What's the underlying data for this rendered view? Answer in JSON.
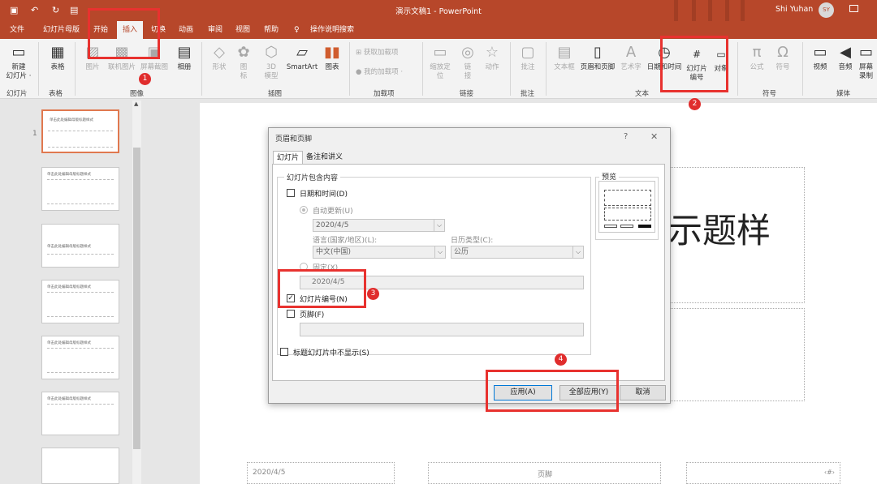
{
  "titlebar": {
    "document_title": "演示文稿1 - PowerPoint",
    "user_name": "Shi Yuhan",
    "user_initials": "SY"
  },
  "tabs": [
    "文件",
    "幻灯片母版",
    "开始",
    "插入",
    "切换",
    "动画",
    "审阅",
    "视图",
    "帮助"
  ],
  "tell_me": "操作说明搜索",
  "ribbon": {
    "new_slide": "新建\n幻灯片 ·",
    "table": "表格",
    "picture": "图片",
    "online_picture": "联机图片",
    "screenshot": "屏幕截图",
    "album": "相册",
    "shapes": "形状",
    "icons": "图\n标",
    "model3d": "3D\n模型",
    "smartart": "SmartArt",
    "chart": "图表",
    "get_addins": "获取加载项",
    "my_addins": "我的加载项",
    "zoom": "缩放定\n位",
    "link": "链\n接",
    "action": "动作",
    "comment": "批注",
    "textbox": "文本框",
    "header_footer": "页眉和页脚",
    "wordart": "艺术字",
    "datetime": "日期和时间",
    "slide_number": "幻灯片\n编号",
    "object": "对象",
    "equation": "公式",
    "symbol": "符号",
    "video": "视频",
    "audio": "音频",
    "screen_record": "屏幕\n录制"
  },
  "groups": [
    "幻灯片",
    "表格",
    "图像",
    "插图",
    "加载项",
    "链接",
    "批注",
    "文本",
    "符号",
    "媒体"
  ],
  "thumbnails": [
    "单击此处编辑母版标题样式",
    "单击此处编辑母版标题样式",
    "单击此处编辑母版标题样式",
    "单击此处编辑母版标题样式",
    "单击此处编辑母版标题样式",
    "单击此处编辑母版标题样式"
  ],
  "slide": {
    "title_partial": "示题样",
    "date": "2020/4/5",
    "footer": "页脚",
    "number": "‹#›"
  },
  "dialog": {
    "title": "页眉和页脚",
    "help": "?",
    "close": "✕",
    "tab_slide": "幻灯片",
    "tab_notes": "备注和讲义",
    "group_label": "幻灯片包含内容",
    "datetime": "日期和时间(D)",
    "auto_update": "自动更新(U)",
    "date_value": "2020/4/5",
    "language_label": "语言(国家/地区)(L):",
    "language_value": "中文(中国)",
    "calendar_label": "日历类型(C):",
    "calendar_value": "公历",
    "fixed": "固定(X)",
    "fixed_value": "2020/4/5",
    "slide_number": "幻灯片编号(N)",
    "footer": "页脚(F)",
    "hide_on_title": "标题幻灯片中不显示(S)",
    "preview": "预览",
    "apply": "应用(A)",
    "apply_all": "全部应用(Y)",
    "cancel": "取消"
  },
  "markers": [
    "1",
    "2",
    "3",
    "4"
  ],
  "accent_color": "#b7472a",
  "annotation_color": "#e8322f"
}
